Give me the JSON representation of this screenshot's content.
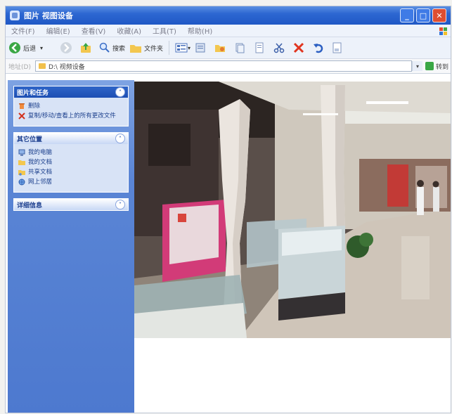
{
  "window": {
    "title": "图片 视图设备",
    "buttons": {
      "minimize": "_",
      "maximize": "□",
      "close": "✕"
    }
  },
  "menu": [
    "文件(F)",
    "编辑(E)",
    "查看(V)",
    "收藏(A)",
    "工具(T)",
    "帮助(H)"
  ],
  "toolbar": {
    "back_label": "后退",
    "search_label": "搜索",
    "folders_label": "文件夹"
  },
  "address": {
    "label": "地址(D)",
    "value": "D:\\ 视频设备",
    "go_label": "转到"
  },
  "sidebar": {
    "panels": [
      {
        "title": "图片和任务",
        "items": [
          "删除",
          "复制/移动/查看上的所有更改文件"
        ]
      },
      {
        "title": "其它位置",
        "items": [
          "我的电脑",
          "我的文档",
          "共享文档",
          "网上邻居"
        ]
      },
      {
        "title": "详细信息",
        "items": []
      }
    ]
  },
  "colors": {
    "titlebar": "#2d67d2",
    "sidebar": "#5a85d5",
    "close": "#de4e32"
  },
  "preview": {
    "subject": "jewelry-store-mall-photo"
  }
}
